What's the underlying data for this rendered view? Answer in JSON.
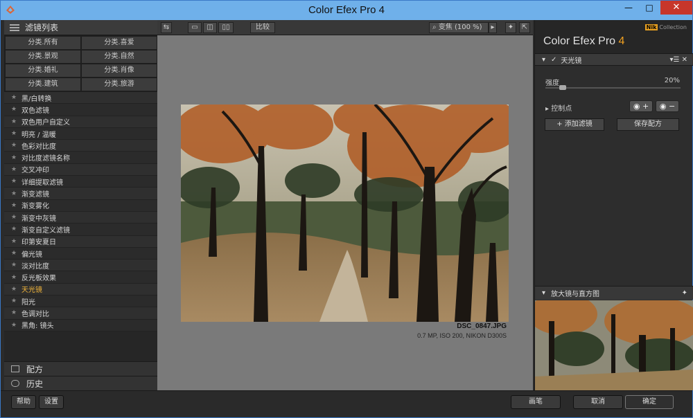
{
  "window": {
    "title": "Color Efex Pro 4",
    "min": "—",
    "max": "□",
    "close": "✕"
  },
  "left": {
    "header": "滤镜列表",
    "categories": [
      "分类.所有",
      "分类.喜爱",
      "分类.景观",
      "分类.自然",
      "分类.婚礼",
      "分类.肖像",
      "分类.建筑",
      "分类.旅游"
    ],
    "filters": [
      "黑/白转换",
      "双色滤镜",
      "双色用户自定义",
      "明亮 / 温暖",
      "色彩对比度",
      "对比度滤镜名称",
      "交叉冲印",
      "详细提取滤镜",
      "渐变滤镜",
      "渐变雾化",
      "渐变中灰镜",
      "渐变自定义滤镜",
      "印第安夏日",
      "偏光镜",
      "淡对比度",
      "反光板效果",
      "天光镜",
      "阳光",
      "色调对比",
      "黑角: 镜头"
    ],
    "active_filter": "天光镜",
    "recipes": "配方",
    "history": "历史"
  },
  "toolbar": {
    "compare": "比较",
    "zoom": "变焦 (100 %)"
  },
  "photo": {
    "filename": "DSC_0847.JPG",
    "info": "0.7 MP, ISO 200, NIKON D300S"
  },
  "right": {
    "brand": "Color Efex Pro",
    "brand_version": "4",
    "nik_logo": "Nik",
    "nik_collection": "Collection",
    "filter_name": "天光镜",
    "strength_label": "强度",
    "strength_value": "20%",
    "strength": 0.2,
    "control_points": "控制点",
    "add_filter": "+ 添加滤镜",
    "save_recipe": "保存配方",
    "loupe": "放大镜与直方图"
  },
  "bottom": {
    "help": "帮助",
    "settings": "设置",
    "brush": "画笔",
    "cancel": "取消",
    "ok": "确定"
  }
}
